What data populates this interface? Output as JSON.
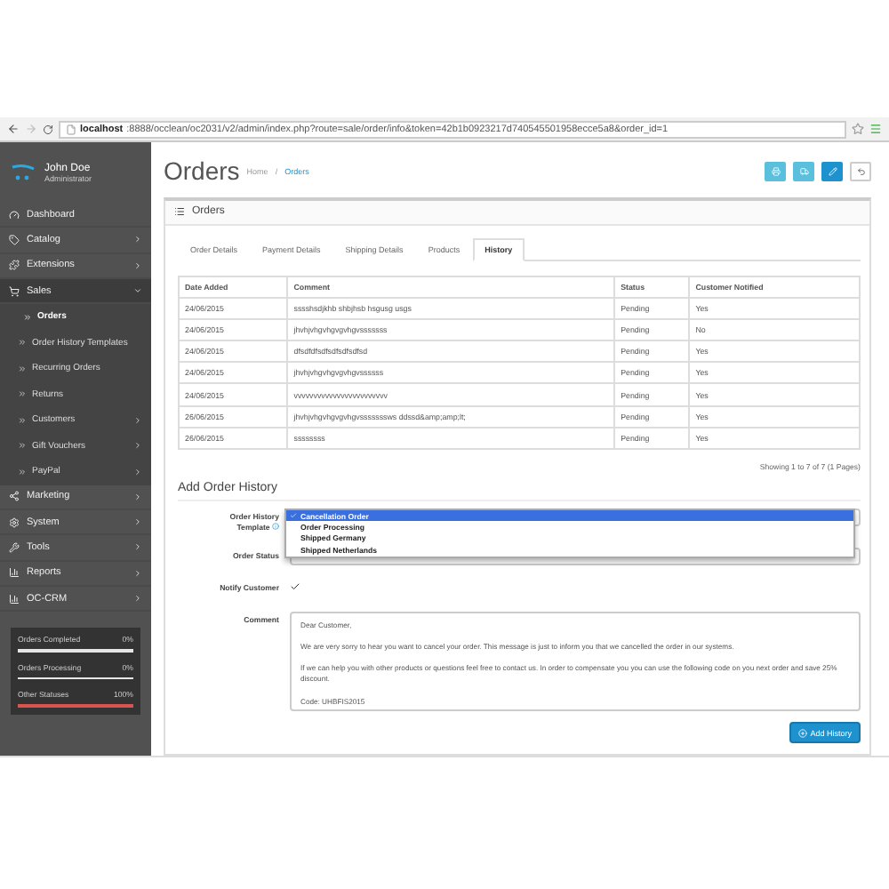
{
  "browser": {
    "url_host": "localhost",
    "url_rest": ":8888/occlean/oc2031/v2/admin/index.php?route=sale/order/info&token=42b1b0923217d740545501958ecce5a8&order_id=1"
  },
  "user": {
    "name": "John Doe",
    "role": "Administrator"
  },
  "sidebar": {
    "items": [
      {
        "label": "Dashboard",
        "has_children": false,
        "expanded": false
      },
      {
        "label": "Catalog",
        "has_children": true,
        "expanded": false
      },
      {
        "label": "Extensions",
        "has_children": true,
        "expanded": false
      },
      {
        "label": "Sales",
        "has_children": true,
        "expanded": true,
        "children": [
          {
            "label": "Orders",
            "selected": true,
            "has_children": false
          },
          {
            "label": "Order History Templates",
            "selected": false,
            "has_children": false
          },
          {
            "label": "Recurring Orders",
            "selected": false,
            "has_children": false
          },
          {
            "label": "Returns",
            "selected": false,
            "has_children": false
          },
          {
            "label": "Customers",
            "selected": false,
            "has_children": true
          },
          {
            "label": "Gift Vouchers",
            "selected": false,
            "has_children": true
          },
          {
            "label": "PayPal",
            "selected": false,
            "has_children": true
          }
        ]
      },
      {
        "label": "Marketing",
        "has_children": true,
        "expanded": false
      },
      {
        "label": "System",
        "has_children": true,
        "expanded": false
      },
      {
        "label": "Tools",
        "has_children": true,
        "expanded": false
      },
      {
        "label": "Reports",
        "has_children": true,
        "expanded": false
      },
      {
        "label": "OC-CRM",
        "has_children": true,
        "expanded": false
      }
    ]
  },
  "stats": [
    {
      "label": "Orders Completed",
      "reading": "0%",
      "level": 0
    },
    {
      "label": "Orders Processing",
      "reading": "0%",
      "level": 0
    },
    {
      "label": "Other Statuses",
      "reading": "100%",
      "level": 1
    }
  ],
  "page": {
    "title": "Orders",
    "breadcrumb": [
      "Home",
      "Orders"
    ],
    "separator": "/"
  },
  "panel": {
    "title": "Orders"
  },
  "tabs": [
    {
      "label": "Order Details",
      "selected": false
    },
    {
      "label": "Payment Details",
      "selected": false
    },
    {
      "label": "Shipping Details",
      "selected": false
    },
    {
      "label": "Products",
      "selected": false
    },
    {
      "label": "History",
      "selected": true
    }
  ],
  "table": {
    "columns": [
      "Date Added",
      "Comment",
      "Status",
      "Customer Notified"
    ],
    "rows": [
      [
        "24/06/2015",
        "sssshsdjkhb shbjhsb hsgusg usgs",
        "Pending",
        "Yes"
      ],
      [
        "24/06/2015",
        "jhvhjvhgvhgvgvhgvsssssss",
        "Pending",
        "No"
      ],
      [
        "24/06/2015",
        "dfsdfdfsdfsdfsdfsdfsd",
        "Pending",
        "Yes"
      ],
      [
        "24/06/2015",
        "jhvhjvhgvhgvgvhgvssssss",
        "Pending",
        "Yes"
      ],
      [
        "24/06/2015",
        "vvvvvvvvvvvvvvvvvvvvvvvv",
        "Pending",
        "Yes"
      ],
      [
        "26/06/2015",
        "jhvhjvhgvhgvgvhgvsssssssws ddssd&amp;amp;lt;",
        "Pending",
        "Yes"
      ],
      [
        "26/06/2015",
        "ssssssss",
        "Pending",
        "Yes"
      ]
    ]
  },
  "pagination": "Showing 1 to 7 of 7 (1 Pages)",
  "form": {
    "title": "Add Order History",
    "template": {
      "label_1": "Order History",
      "label_2": "Template",
      "options": [
        {
          "label": "Cancellation Order",
          "selected": true
        },
        {
          "label": "Order Processing",
          "selected": false
        },
        {
          "label": "Shipped Germany",
          "selected": false
        },
        {
          "label": "Shipped Netherlands",
          "selected": false
        }
      ]
    },
    "status": {
      "label": "Order Status"
    },
    "notify": {
      "label": "Notify Customer",
      "checked": true
    },
    "comment": {
      "label": "Comment",
      "value": "Dear Customer,\n\nWe are very sorry to hear you want to cancel your order. This message is just to inform you that we cancelled the order in our systems.\n\nIf we can help you with other products or questions feel free to contact us. In order to compensate you you can use the following code on you next order and save 25% discount.\n\nCode: UHBFIS2015"
    },
    "submit": "Add History"
  }
}
